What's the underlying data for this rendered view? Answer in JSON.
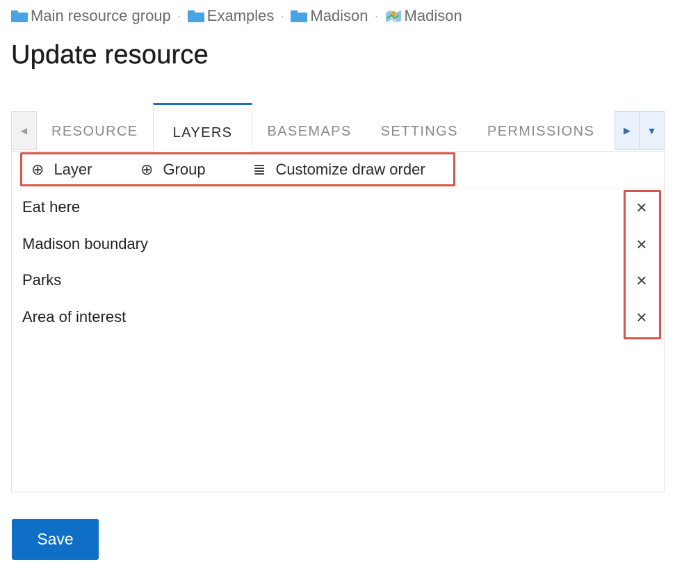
{
  "breadcrumb": {
    "items": [
      {
        "label": "Main resource group",
        "icon": "folder-icon"
      },
      {
        "label": "Examples",
        "icon": "folder-icon"
      },
      {
        "label": "Madison",
        "icon": "folder-icon"
      },
      {
        "label": "Madison",
        "icon": "map-icon"
      }
    ],
    "separator": "·"
  },
  "page": {
    "title": "Update resource"
  },
  "tabs": {
    "items": [
      {
        "label": "RESOURCE",
        "active": false
      },
      {
        "label": "LAYERS",
        "active": true
      },
      {
        "label": "BASEMAPS",
        "active": false
      },
      {
        "label": "SETTINGS",
        "active": false
      },
      {
        "label": "PERMISSIONS",
        "active": false
      }
    ],
    "scroll_left_icon": "◀",
    "scroll_right_icon": "▶",
    "dropdown_icon": "▼"
  },
  "toolbar": {
    "add_layer_icon": "⊕",
    "add_layer_label": "Layer",
    "add_group_icon": "⊕",
    "add_group_label": "Group",
    "draw_order_icon": "≣",
    "draw_order_label": "Customize draw order"
  },
  "layers": {
    "items": [
      {
        "name": "Eat here"
      },
      {
        "name": "Madison boundary"
      },
      {
        "name": "Parks"
      },
      {
        "name": "Area of interest"
      }
    ],
    "remove_icon": "×"
  },
  "actions": {
    "save_label": "Save"
  },
  "colors": {
    "accent": "#0f6fc6",
    "active_tab_border": "#1c6fb8",
    "highlight": "#d2564c",
    "folder": "#4aa3df"
  }
}
